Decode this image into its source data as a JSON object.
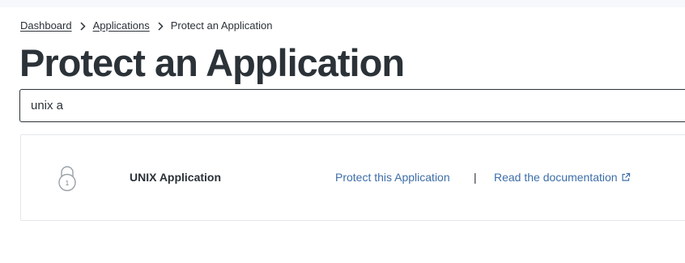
{
  "breadcrumb": {
    "items": [
      {
        "label": "Dashboard"
      },
      {
        "label": "Applications"
      }
    ],
    "current": "Protect an Application",
    "separator_icon": "chevron-right-icon"
  },
  "page": {
    "title": "Protect an Application"
  },
  "search": {
    "value": "unix a"
  },
  "results": [
    {
      "icon": "lock-icon",
      "lock_number": "1",
      "name": "UNIX Application",
      "protect_label": "Protect this Application",
      "separator": "|",
      "docs_label": "Read the documentation",
      "docs_icon": "external-link-icon"
    }
  ],
  "colors": {
    "text": "#2b3238",
    "link": "#3d6ea8",
    "card_border": "#e4e6ea"
  }
}
